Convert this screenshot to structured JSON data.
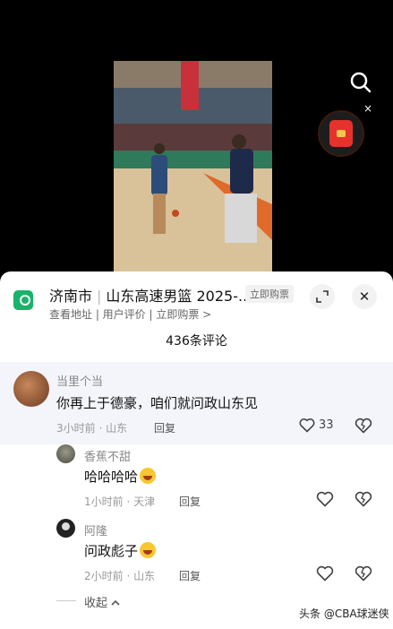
{
  "video": {
    "search_icon": "search-icon",
    "redpacket_icon": "red-packet-icon",
    "close_symbol": "×"
  },
  "location": {
    "city": "济南市",
    "team": "山东高速男篮 2025-...",
    "buy_tag": "立即购票",
    "subtitle": "查看地址 | 用户评价 | 立即购票 >",
    "expand_icon": "expand-icon",
    "close_symbol": "✕"
  },
  "comments_header": "436条评论",
  "comments": [
    {
      "author": "当里个当",
      "text": "你再上于德豪，咱们就问政山东见",
      "meta": "3小时前 · 山东",
      "reply": "回复",
      "likes": "33"
    }
  ],
  "replies": [
    {
      "author": "香蕉不甜",
      "text": "哈哈哈哈",
      "emoji": "laughing-emoji",
      "meta": "1小时前 · 天津",
      "reply": "回复"
    },
    {
      "author": "阿隆",
      "text": "问政彪子",
      "emoji": "grinning-emoji",
      "meta": "2小时前 · 山东",
      "reply": "回复"
    }
  ],
  "collapse_label": "收起",
  "watermark": "头条 @CBA球迷侠"
}
